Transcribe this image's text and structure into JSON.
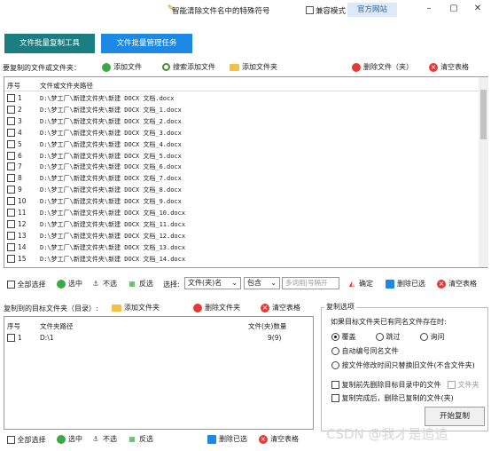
{
  "window": {
    "title": "智能清除文件名中的特殊符号",
    "compat_mode_label": "兼容模式",
    "official_site_label": "官方网站",
    "minimize_glyph": "–",
    "maximize_glyph": "▢",
    "close_glyph": "✕"
  },
  "tabs": [
    {
      "label": "文件批量复制工具",
      "active": true
    },
    {
      "label": "文件批量管理任务",
      "active": false
    }
  ],
  "source_toolbar": {
    "label": "要复制的文件或文件夹：",
    "add_file": "添加文件",
    "search_add_file": "搜索添加文件",
    "add_folder": "添加文件夹",
    "delete_files": "删除文件（夹）",
    "clear_table": "清空表格"
  },
  "source_table": {
    "col_index": "序号",
    "col_path": "文件或文件夹路径",
    "rows": [
      {
        "index": "1",
        "path": "D:\\梦工厂\\新建文件夹\\新建 DOCX 文档.docx"
      },
      {
        "index": "2",
        "path": "D:\\梦工厂\\新建文件夹\\新建 DOCX 文档_1.docx"
      },
      {
        "index": "3",
        "path": "D:\\梦工厂\\新建文件夹\\新建 DOCX 文档_2.docx"
      },
      {
        "index": "4",
        "path": "D:\\梦工厂\\新建文件夹\\新建 DOCX 文档_3.docx"
      },
      {
        "index": "5",
        "path": "D:\\梦工厂\\新建文件夹\\新建 DOCX 文档_4.docx"
      },
      {
        "index": "6",
        "path": "D:\\梦工厂\\新建文件夹\\新建 DOCX 文档_5.docx"
      },
      {
        "index": "7",
        "path": "D:\\梦工厂\\新建文件夹\\新建 DOCX 文档_6.docx"
      },
      {
        "index": "8",
        "path": "D:\\梦工厂\\新建文件夹\\新建 DOCX 文档_7.docx"
      },
      {
        "index": "9",
        "path": "D:\\梦工厂\\新建文件夹\\新建 DOCX 文档_8.docx"
      },
      {
        "index": "10",
        "path": "D:\\梦工厂\\新建文件夹\\新建 DOCX 文档_9.docx"
      },
      {
        "index": "11",
        "path": "D:\\梦工厂\\新建文件夹\\新建 DOCX 文档_10.docx"
      },
      {
        "index": "12",
        "path": "D:\\梦工厂\\新建文件夹\\新建 DOCX 文档_11.docx"
      },
      {
        "index": "13",
        "path": "D:\\梦工厂\\新建文件夹\\新建 DOCX 文档_12.docx"
      },
      {
        "index": "14",
        "path": "D:\\梦工厂\\新建文件夹\\新建 DOCX 文档_13.docx"
      },
      {
        "index": "15",
        "path": "D:\\梦工厂\\新建文件夹\\新建 DOCX 文档_14.docx"
      }
    ]
  },
  "source_select_bar": {
    "select_all": "全部选择",
    "select": "选中",
    "unselect": "不选",
    "invert": "反选",
    "choose_label": "选择:",
    "type_select": "文件(夹)名",
    "match_select": "包含",
    "keyword_placeholder": "多词用|号隔开",
    "confirm": "确定",
    "delete_selected": "删除已选",
    "clear_table": "清空表格"
  },
  "target_toolbar": {
    "label": "复制到的目标文件夹（目录）:",
    "add_folder": "添加文件夹",
    "delete_folder": "删除文件夹",
    "clear_table": "清空表格"
  },
  "target_table": {
    "col_index": "序号",
    "col_path": "文件夹路径",
    "col_count": "文件(夹)数量",
    "rows": [
      {
        "index": "1",
        "path": "D:\\1",
        "count": "9(9)"
      }
    ]
  },
  "target_select_bar": {
    "select_all": "全部选择",
    "select": "选中",
    "unselect": "不选",
    "invert": "反选",
    "delete_selected": "删除已选",
    "clear_table": "清空表格"
  },
  "copy_options": {
    "title": "复制选项",
    "question": "如果目标文件夹已有同名文件存在时:",
    "overwrite": "覆盖",
    "skip": "跳过",
    "ask": "询问",
    "auto_rename": "自动编号同名文件",
    "replace_older": "按文件修改时间只替换旧文件(不含文件夹)",
    "clear_before": "复制前先删除目标目录中的文件",
    "folder_opt": "文件夹",
    "delete_after": "复制完成后，删除已复制的文件(夹)",
    "selected_radio": "overwrite"
  },
  "start_button": "开始复制",
  "watermark": "CSDN @我才是追追"
}
